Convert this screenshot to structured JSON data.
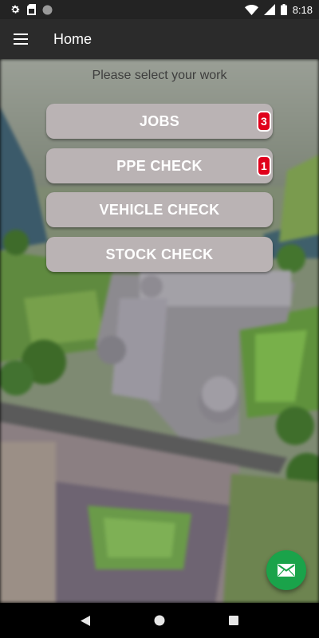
{
  "status_bar": {
    "time": "8:18",
    "left_icons": [
      "gear-icon",
      "sim-card-icon",
      "circle-icon"
    ],
    "right_icons": [
      "wifi-icon",
      "signal-icon",
      "battery-icon"
    ]
  },
  "app_bar": {
    "title": "Home",
    "menu_icon": "hamburger-menu-icon"
  },
  "prompt": "Please select your work",
  "buttons": [
    {
      "label": "JOBS",
      "badge": "3"
    },
    {
      "label": "PPE CHECK",
      "badge": "1"
    },
    {
      "label": "VEHICLE CHECK"
    },
    {
      "label": "STOCK CHECK"
    }
  ],
  "colors": {
    "button_bg": "#bab3b4",
    "badge_bg": "#e0001b",
    "fab_bg": "#1aa34a",
    "app_bar_bg": "#2b2b2b"
  },
  "fab": {
    "icon": "email-icon"
  },
  "nav_bar": {
    "icons": [
      "back-icon",
      "home-icon",
      "recents-icon"
    ]
  }
}
